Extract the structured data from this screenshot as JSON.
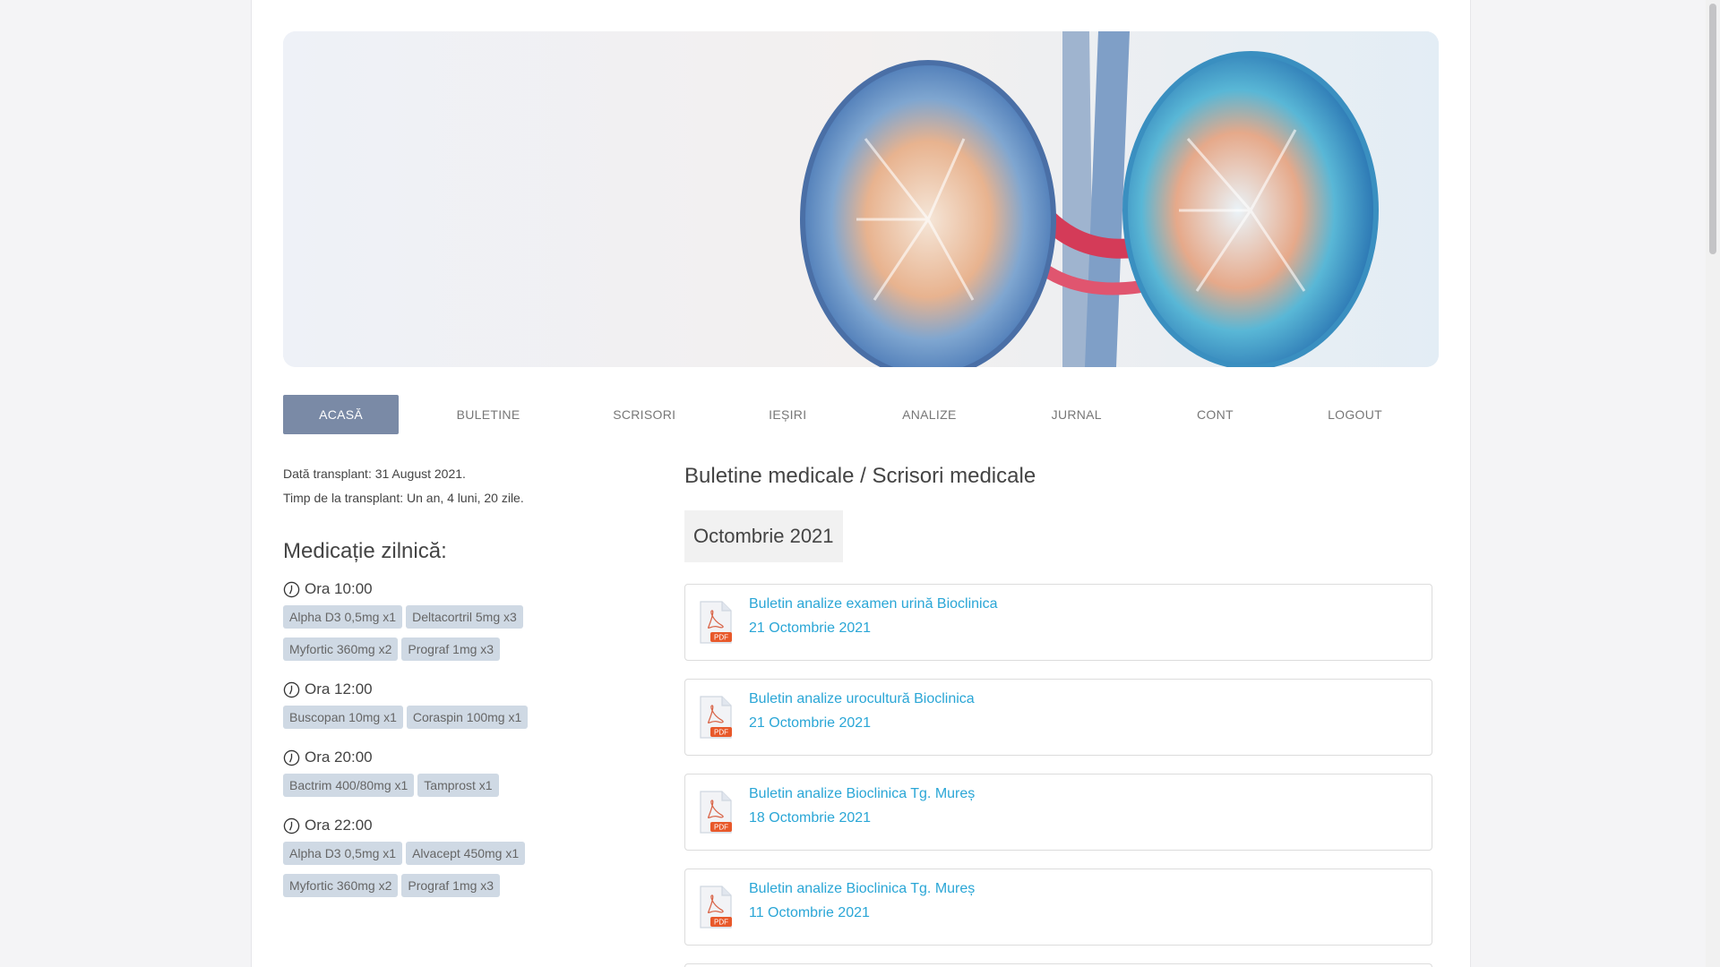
{
  "nav": {
    "items": [
      {
        "label": "ACASĂ",
        "active": true
      },
      {
        "label": "BULETINE",
        "active": false
      },
      {
        "label": "SCRISORI",
        "active": false
      },
      {
        "label": "IEȘIRI",
        "active": false
      },
      {
        "label": "ANALIZE",
        "active": false
      },
      {
        "label": "JURNAL",
        "active": false
      },
      {
        "label": "CONT",
        "active": false
      },
      {
        "label": "LOGOUT",
        "active": false
      }
    ]
  },
  "info": {
    "transplant_date": "Dată transplant: 31 August 2021.",
    "time_since": "Timp de la transplant: Un an, 4 luni, 20 zile."
  },
  "medication": {
    "title": "Medicație zilnică:",
    "schedule": [
      {
        "time": "Ora 10:00",
        "pills": [
          "Alpha D3 0,5mg x1",
          "Deltacortril 5mg x3",
          "Myfortic 360mg x2",
          "Prograf 1mg x3"
        ]
      },
      {
        "time": "Ora 12:00",
        "pills": [
          "Buscopan 10mg x1",
          "Coraspin 100mg x1"
        ]
      },
      {
        "time": "Ora 20:00",
        "pills": [
          "Bactrim 400/80mg x1",
          "Tamprost x1"
        ]
      },
      {
        "time": "Ora 22:00",
        "pills": [
          "Alpha D3 0,5mg x1",
          "Alvacept 450mg x1",
          "Myfortic 360mg x2",
          "Prograf 1mg x3"
        ]
      }
    ]
  },
  "documents": {
    "title": "Buletine medicale / Scrisori medicale",
    "month": "Octombrie 2021",
    "items": [
      {
        "title": "Buletin analize examen urină Bioclinica",
        "date": "21 Octombrie 2021",
        "badge": "PDF"
      },
      {
        "title": "Buletin analize urocultură Bioclinica",
        "date": "21 Octombrie 2021",
        "badge": "PDF"
      },
      {
        "title": "Buletin analize Bioclinica Tg. Mureș",
        "date": "18 Octombrie 2021",
        "badge": "PDF"
      },
      {
        "title": "Buletin analize Bioclinica Tg. Mureș",
        "date": "11 Octombrie 2021",
        "badge": "PDF"
      }
    ]
  },
  "colors": {
    "accent_link": "#2aa6d6",
    "nav_active": "#7a8aa6",
    "pill_bg": "#cfd9e4",
    "pdf_badge": "#e8582a"
  }
}
